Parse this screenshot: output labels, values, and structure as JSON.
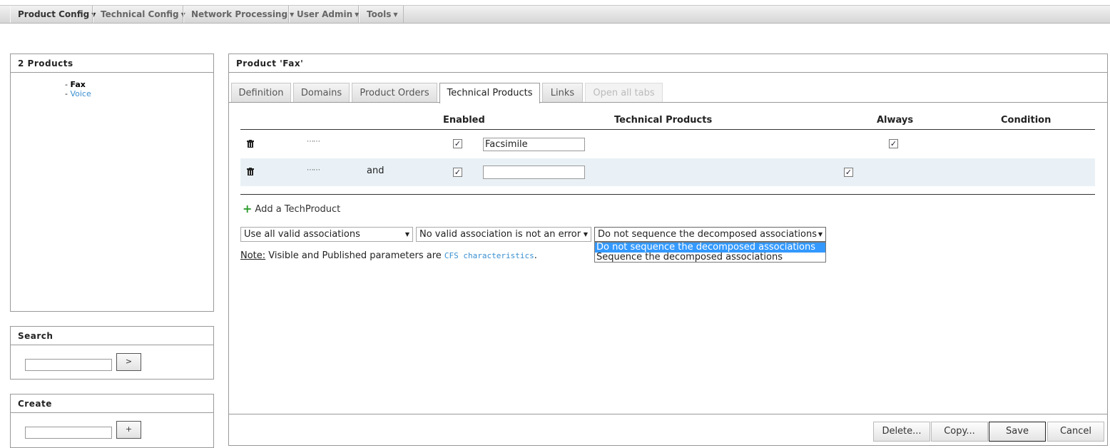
{
  "menu": [
    {
      "label": "Product Config",
      "active": true
    },
    {
      "label": "Technical Config"
    },
    {
      "label": "Network Processing"
    },
    {
      "label": "User Admin"
    },
    {
      "label": "Tools"
    }
  ],
  "products_panel": {
    "title": "2 Products",
    "items": [
      {
        "label": "Fax",
        "selected": true
      },
      {
        "label": "Voice"
      }
    ]
  },
  "search_panel": {
    "title": "Search",
    "input_value": "",
    "button_label": ">"
  },
  "create_panel": {
    "title": "Create",
    "input_value": "",
    "button_label": "+"
  },
  "product": {
    "title": "Product 'Fax'",
    "tabs": [
      {
        "label": "Definition"
      },
      {
        "label": "Domains"
      },
      {
        "label": "Product Orders"
      },
      {
        "label": "Technical Products",
        "active": true
      },
      {
        "label": "Links"
      },
      {
        "label": "Open all tabs",
        "disabled": true
      }
    ],
    "table": {
      "headers": {
        "enabled": "Enabled",
        "technical_products": "Technical Products",
        "always": "Always",
        "condition": "Condition"
      },
      "rows": [
        {
          "prefix": "",
          "enabled": true,
          "product": "Facsimile",
          "always": true
        },
        {
          "prefix": "and",
          "enabled": true,
          "product": "",
          "always": true
        }
      ]
    },
    "add_label": "Add a TechProduct",
    "selects": [
      {
        "value": "Use all valid associations"
      },
      {
        "value": "No valid association is not an error"
      },
      {
        "value": "Do not sequence the decomposed associations"
      }
    ],
    "dropdown_options": [
      "Do not sequence the decomposed associations",
      "Sequence the decomposed associations"
    ],
    "note": {
      "label": "Note:",
      "text_before": " Visible and Published parameters are ",
      "link": "CFS characteristics",
      "text_after": "."
    },
    "buttons": {
      "delete": "Delete...",
      "copy": "Copy...",
      "save": "Save",
      "cancel": "Cancel"
    }
  },
  "colors": {
    "link": "#3a8fd0",
    "highlight": "#3399ff",
    "row_alt": "#e9f1f6",
    "add_icon": "#2e9c2e"
  }
}
